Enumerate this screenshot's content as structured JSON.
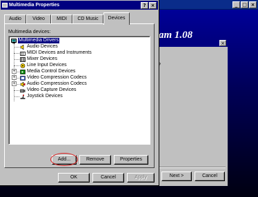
{
  "background": {
    "window_caption_buttons": [
      "_",
      "□",
      "×"
    ],
    "left_marks": [
      "V",
      "V"
    ],
    "heading": "am 1.08",
    "dialog": {
      "close_glyph": "×",
      "question_fragment": "?",
      "next_label": "Next >",
      "cancel_label": "Cancel"
    }
  },
  "window": {
    "title": "Multimedia Properties",
    "help_glyph": "?",
    "close_glyph": "×"
  },
  "tabs": [
    {
      "label": "Audio"
    },
    {
      "label": "Video"
    },
    {
      "label": "MIDI"
    },
    {
      "label": "CD Music"
    },
    {
      "label": "Devices",
      "active": true
    }
  ],
  "devices": {
    "label": "Multimedia devices:",
    "root": "Multimedia Drivers",
    "items": [
      {
        "label": "Audio Devices"
      },
      {
        "label": "MIDI Devices and Instruments"
      },
      {
        "label": "Mixer Devices"
      },
      {
        "label": "Line Input Devices"
      },
      {
        "label": "Media Control Devices",
        "expander": "+"
      },
      {
        "label": "Video Compression Codecs",
        "expander": "+"
      },
      {
        "label": "Audio Compression Codecs",
        "expander": "+"
      },
      {
        "label": "Video Capture Devices"
      },
      {
        "label": "Joystick Devices"
      }
    ]
  },
  "buttons": {
    "add": "Add...",
    "remove": "Remove",
    "properties": "Properties",
    "ok": "OK",
    "cancel": "Cancel",
    "apply": "Apply"
  },
  "colors": {
    "titlebar": "#000080",
    "face": "#c0c0c0",
    "highlight_ellipse": "#d91c1c"
  }
}
